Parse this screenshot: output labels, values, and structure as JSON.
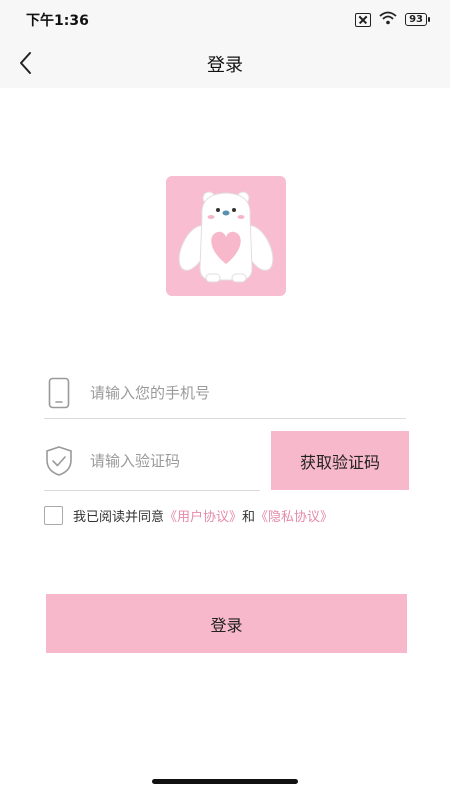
{
  "status_bar": {
    "time": "下午1:36",
    "battery": "93"
  },
  "header": {
    "title": "登录"
  },
  "form": {
    "phone_placeholder": "请输入您的手机号",
    "code_placeholder": "请输入验证码",
    "get_code_label": "获取验证码"
  },
  "agreement": {
    "checked": false,
    "prefix": "我已阅读并同意",
    "user_agreement": "《用户协议》",
    "conjunction": "和",
    "privacy_policy": "《隐私协议》"
  },
  "login_button_label": "登录",
  "colors": {
    "accent": "#f8b8cc",
    "link": "#e58aa8",
    "logo_bg": "#f8bdd0"
  }
}
